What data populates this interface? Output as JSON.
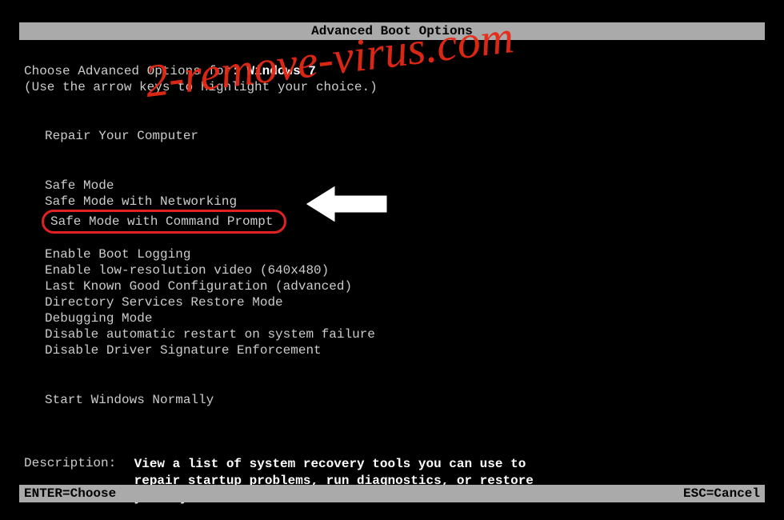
{
  "title": "Advanced Boot Options",
  "prompt_prefix": "Choose Advanced Options for: ",
  "os_name": "Windows 7",
  "hint": "(Use the arrow keys to highlight your choice.)",
  "repair_label": "Repair Your Computer",
  "options_a": [
    "Safe Mode",
    "Safe Mode with Networking",
    "Safe Mode with Command Prompt"
  ],
  "options_b": [
    "Enable Boot Logging",
    "Enable low-resolution video (640x480)",
    "Last Known Good Configuration (advanced)",
    "Directory Services Restore Mode",
    "Debugging Mode",
    "Disable automatic restart on system failure",
    "Disable Driver Signature Enforcement"
  ],
  "options_c": [
    "Start Windows Normally"
  ],
  "highlighted_index": 2,
  "description_label": "Description:",
  "description_text": "View a list of system recovery tools you can use to repair startup problems, run diagnostics, or restore your system.",
  "footer_left": "ENTER=Choose",
  "footer_right": "ESC=Cancel",
  "watermark": "2-remove-virus.com"
}
